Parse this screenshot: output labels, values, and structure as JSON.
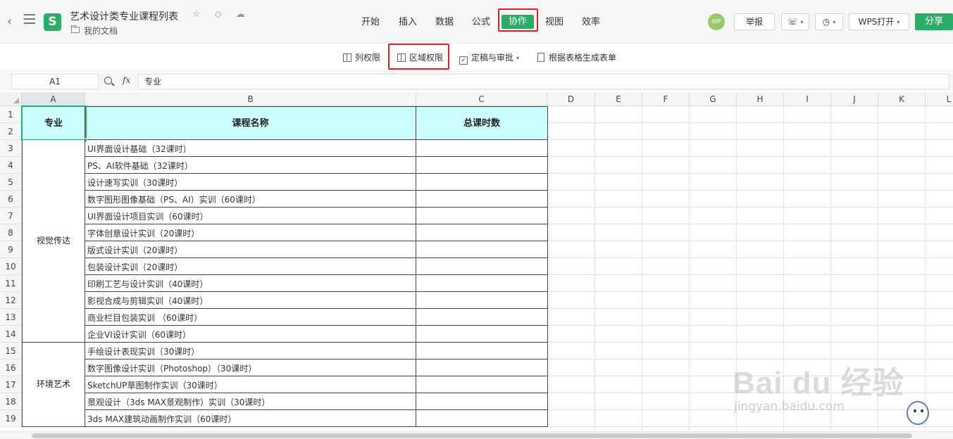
{
  "document": {
    "title": "艺术设计类专业课程列表",
    "location": "我的文档",
    "title_icons": "☆ ◇ ☁"
  },
  "menu_tabs": [
    "开始",
    "插入",
    "数据",
    "公式",
    "协作",
    "视图",
    "效率"
  ],
  "active_tab": "协作",
  "user": {
    "avatar_text": "WP"
  },
  "header_buttons": {
    "report": "举报",
    "wps_open": "WPS打开",
    "share": "分享"
  },
  "ribbon": {
    "column_permission": "列权限",
    "area_permission": "区域权限",
    "finalize_approve": "定稿与审批",
    "generate_form": "根据表格生成表单"
  },
  "formula_bar": {
    "cell_ref": "A1",
    "fx_label": "fx",
    "value": "专业"
  },
  "columns": [
    "A",
    "B",
    "C",
    "D",
    "E",
    "F",
    "G",
    "H",
    "I",
    "J",
    "K",
    "L"
  ],
  "rows": [
    "1",
    "2",
    "3",
    "4",
    "5",
    "6",
    "7",
    "8",
    "9",
    "10",
    "11",
    "12",
    "13",
    "14",
    "15",
    "16",
    "17",
    "18",
    "19"
  ],
  "table": {
    "headers": {
      "major": "专业",
      "course": "课程名称",
      "hours": "总课时数"
    },
    "groups": [
      {
        "major": "视觉传达",
        "courses": [
          "UI界面设计基础（32课时）",
          "PS、AI软件基础（32课时）",
          "设计速写实训（30课时）",
          "数字图形图像基础（PS、AI）实训（60课时）",
          "UI界面设计项目实训（60课时）",
          "字体创意设计实训（20课时）",
          "版式设计实训（20课时）",
          "包装设计实训（20课时）",
          "印刷工艺与设计实训（40课时）",
          "影视合成与剪辑实训（40课时）",
          "商业栏目包装实训 （60课时）",
          "企业VI设计实训（60课时）"
        ]
      },
      {
        "major": "环境艺术",
        "courses": [
          "手绘设计表现实训（30课时）",
          "数字图像设计实训（Photoshop）（30课时）",
          "SketchUP草图制作实训（30课时）",
          "景观设计（3ds MAX景观制作）实训（30课时）",
          "3ds MAX建筑动画制作实训（60课时）"
        ]
      }
    ]
  },
  "watermark": {
    "logo": "Bai du 经验",
    "url": "jingyan.baidu.com"
  },
  "colors": {
    "accent": "#2aae67",
    "highlight": "#e02020",
    "header_fill": "#ccfdff"
  }
}
